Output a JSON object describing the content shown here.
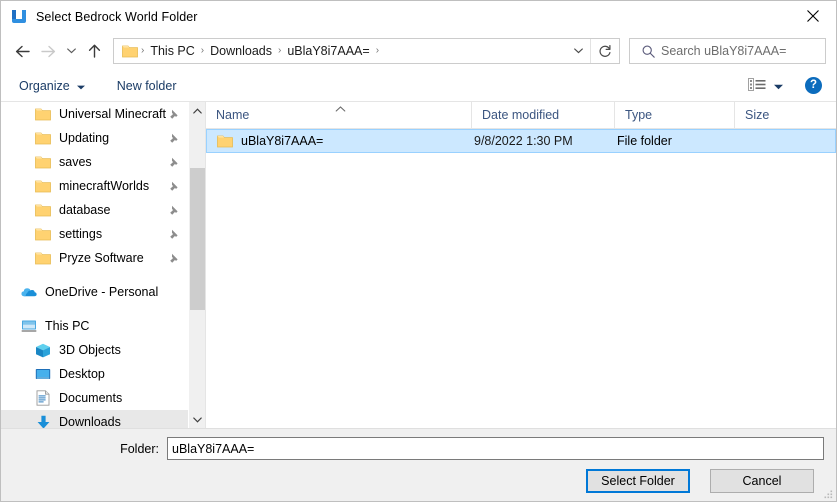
{
  "window": {
    "title": "Select Bedrock World Folder",
    "icon": "app-icon",
    "close_label": "✕"
  },
  "nav": {
    "back": "back-arrow",
    "forward": "forward-arrow",
    "recent": "recent-dropdown",
    "up": "up-arrow",
    "refresh": "refresh-icon",
    "breadcrumbs": [
      "This PC",
      "Downloads",
      "uBlaY8i7AAA="
    ],
    "separator": "›",
    "dropdown": "chevron-down-icon"
  },
  "search": {
    "placeholder": "Search uBlaY8i7AAA=",
    "icon": "search-icon"
  },
  "toolbar": {
    "organize_label": "Organize",
    "new_folder_label": "New folder",
    "view_icon": "view-layout-icon",
    "help_label": "?"
  },
  "sidebar": {
    "quick_access": [
      {
        "label": "Universal Minecraft Too",
        "icon": "folder-icon",
        "pinned": true
      },
      {
        "label": "Updating",
        "icon": "folder-icon",
        "pinned": true
      },
      {
        "label": "saves",
        "icon": "folder-icon",
        "pinned": true
      },
      {
        "label": "minecraftWorlds",
        "icon": "folder-icon",
        "pinned": true
      },
      {
        "label": "database",
        "icon": "folder-icon",
        "pinned": true
      },
      {
        "label": "settings",
        "icon": "folder-icon",
        "pinned": true
      },
      {
        "label": "Pryze Software",
        "icon": "folder-icon",
        "pinned": true
      }
    ],
    "onedrive": {
      "label": "OneDrive - Personal",
      "icon": "cloud-icon"
    },
    "this_pc": {
      "label": "This PC",
      "icon": "monitor-icon"
    },
    "this_pc_children": [
      {
        "label": "3D Objects",
        "icon": "cube-icon",
        "selected": false
      },
      {
        "label": "Desktop",
        "icon": "desktop-icon",
        "selected": false
      },
      {
        "label": "Documents",
        "icon": "document-icon",
        "selected": false
      },
      {
        "label": "Downloads",
        "icon": "download-icon",
        "selected": true
      }
    ],
    "scrollbar": {
      "up": "scroll-up-icon",
      "down": "scroll-down-icon"
    }
  },
  "filelist": {
    "columns": [
      "Name",
      "Date modified",
      "Type",
      "Size"
    ],
    "sort_indicator": "sort-ascending-icon",
    "rows": [
      {
        "name": "uBlaY8i7AAA=",
        "date_modified": "9/8/2022 1:30 PM",
        "type": "File folder",
        "size": "",
        "icon": "folder-icon",
        "selected": true
      }
    ]
  },
  "footer": {
    "folder_label": "Folder:",
    "folder_value": "uBlaY8i7AAA=",
    "select_button": "Select Folder",
    "cancel_button": "Cancel"
  },
  "colors": {
    "accent": "#0078d7",
    "selection": "#cce8ff",
    "folder_yellow": "#ffd271",
    "header_text": "#3b5580",
    "footer_bg": "#f0f0f0"
  }
}
